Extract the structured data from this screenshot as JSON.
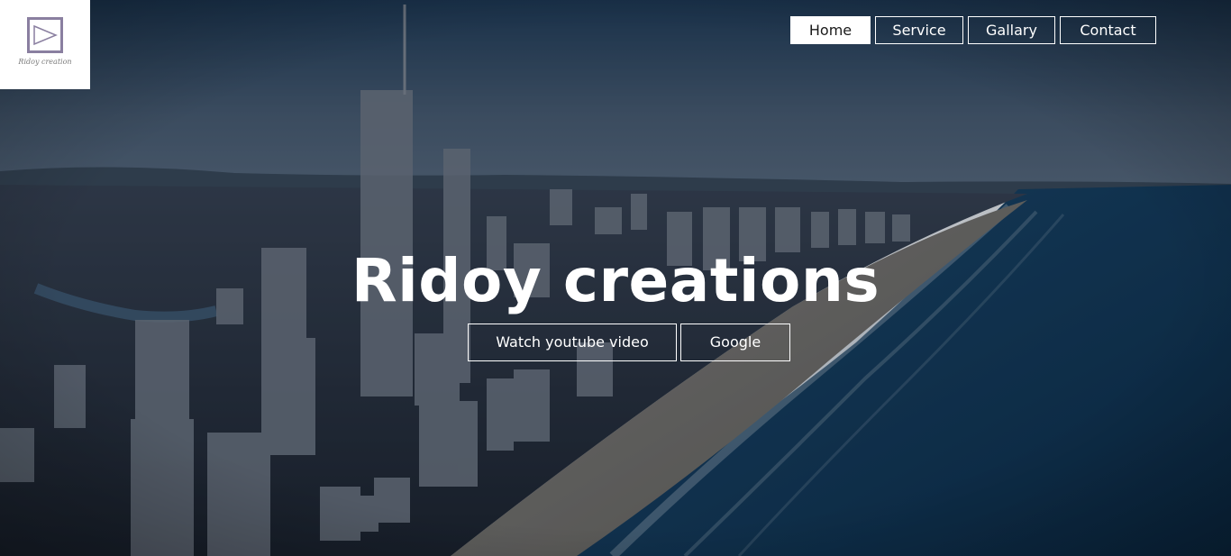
{
  "brand": {
    "logo_text": "Ridoy creation"
  },
  "nav": {
    "items": [
      {
        "label": "Home",
        "active": true
      },
      {
        "label": "Service",
        "active": false
      },
      {
        "label": "Gallary",
        "active": false
      },
      {
        "label": "Contact",
        "active": false
      }
    ]
  },
  "hero": {
    "title": "Ridoy creations",
    "buttons": [
      {
        "label": "Watch youtube video"
      },
      {
        "label": "Google"
      }
    ],
    "background_image": "aerial city skyline by the beach"
  },
  "colors": {
    "sky": "#4f6174",
    "ocean": "#0f3452",
    "overlay": "#0a1a2a",
    "accent": "#ffffff",
    "logo_frame": "#8a7fa0"
  }
}
